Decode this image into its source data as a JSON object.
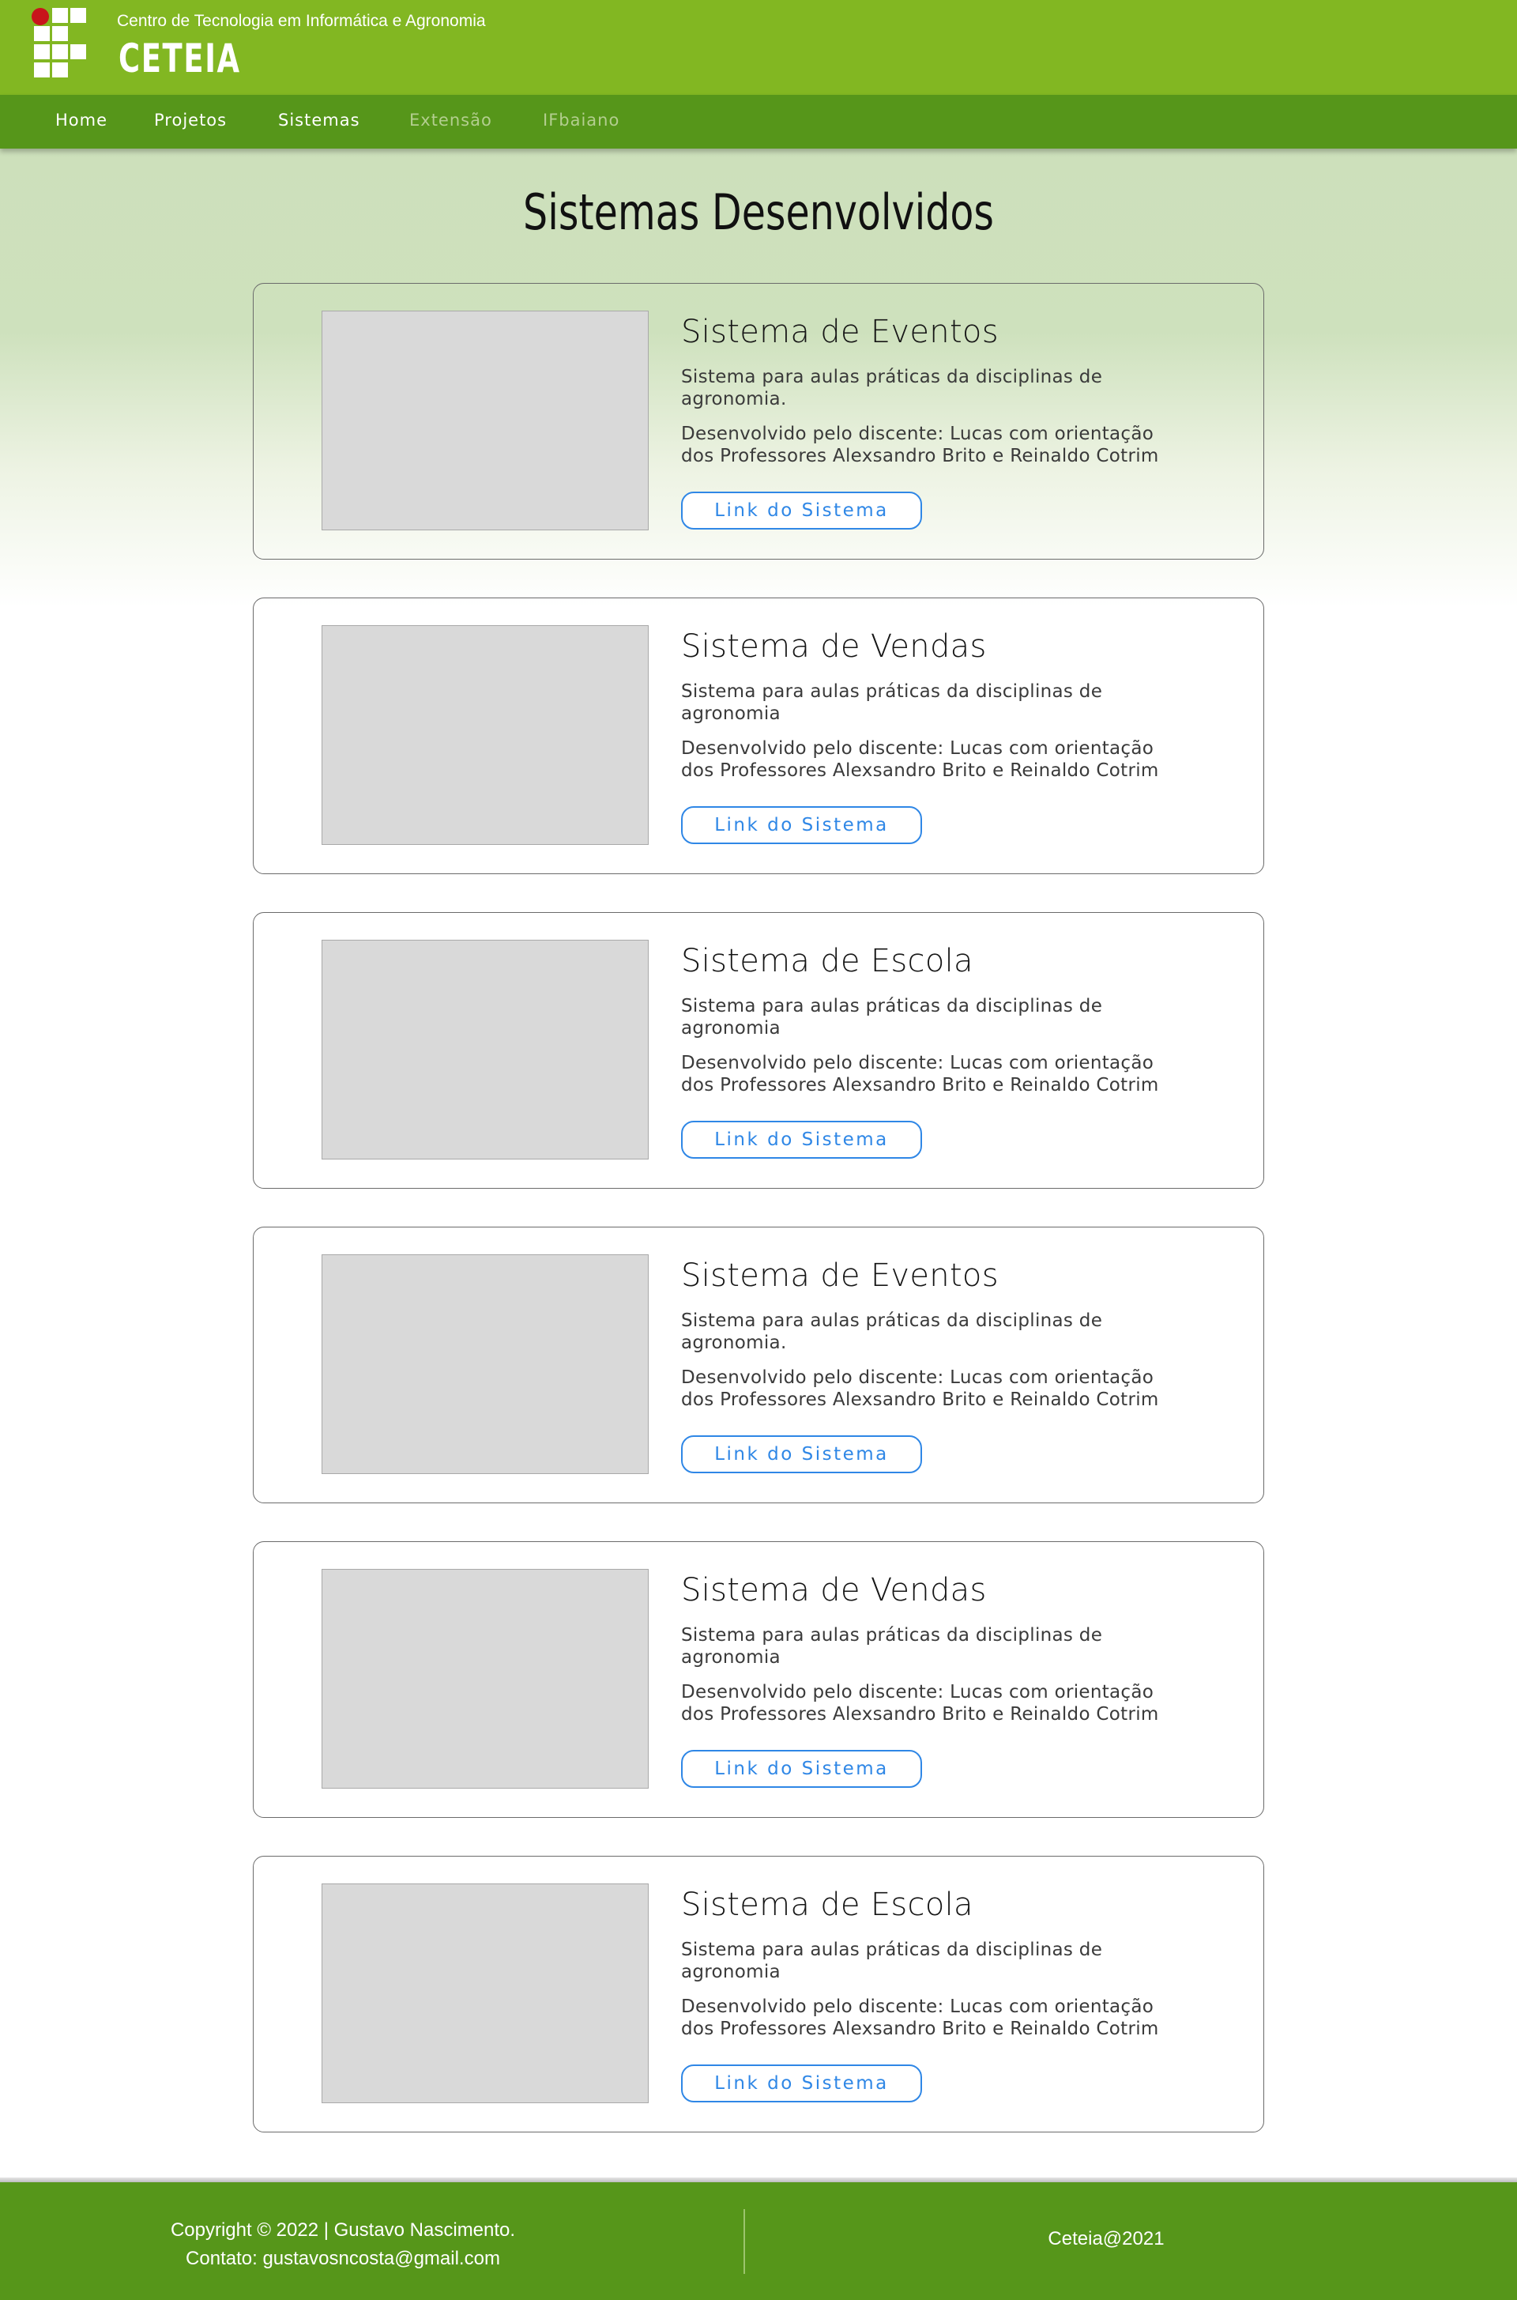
{
  "header": {
    "org_name": "Centro de Tecnologia em Informática e Agronomia",
    "brand": "CETEIA"
  },
  "nav": {
    "items": [
      {
        "label": "Home"
      },
      {
        "label": "Projetos"
      },
      {
        "label": "Sistemas"
      },
      {
        "label": "Extensão"
      },
      {
        "label": "IFbaiano"
      }
    ]
  },
  "main": {
    "title": "Sistemas Desenvolvidos",
    "cards": [
      {
        "title": "Sistema de Eventos",
        "description": "Sistema para aulas práticas da disciplinas de agronomia.",
        "developer": "Desenvolvido pelo discente: Lucas com orientação dos Professores Alexsandro Brito e Reinaldo Cotrim",
        "button": "Link do Sistema"
      },
      {
        "title": "Sistema de Vendas",
        "description": "Sistema para aulas práticas da disciplinas de agronomia",
        "developer": "Desenvolvido pelo discente: Lucas com orientação dos Professores Alexsandro Brito e Reinaldo Cotrim",
        "button": "Link do Sistema"
      },
      {
        "title": "Sistema de Escola",
        "description": "Sistema para aulas práticas da disciplinas de agronomia",
        "developer": "Desenvolvido pelo discente: Lucas com orientação dos Professores Alexsandro Brito e Reinaldo Cotrim",
        "button": "Link do Sistema"
      },
      {
        "title": "Sistema de Eventos",
        "description": "Sistema para aulas práticas da disciplinas de agronomia.",
        "developer": "Desenvolvido pelo discente: Lucas com orientação dos Professores Alexsandro Brito e Reinaldo Cotrim",
        "button": "Link do Sistema"
      },
      {
        "title": "Sistema de Vendas",
        "description": "Sistema para aulas práticas da disciplinas de agronomia",
        "developer": "Desenvolvido pelo discente: Lucas com orientação dos Professores Alexsandro Brito e Reinaldo Cotrim",
        "button": "Link do Sistema"
      },
      {
        "title": "Sistema de Escola",
        "description": "Sistema para aulas práticas da disciplinas de agronomia",
        "developer": "Desenvolvido pelo discente: Lucas com orientação dos Professores Alexsandro Brito e Reinaldo Cotrim",
        "button": "Link do Sistema"
      }
    ]
  },
  "footer": {
    "copyright": "Copyright © 2022 | Gustavo Nascimento.",
    "contact": "Contato: gustavosncosta@gmail.com",
    "right_text": "Ceteia@2021"
  },
  "colors": {
    "header_green": "#82b722",
    "nav_green": "#56961a",
    "link_blue": "#2f87e6",
    "logo_red": "#c8141b"
  }
}
